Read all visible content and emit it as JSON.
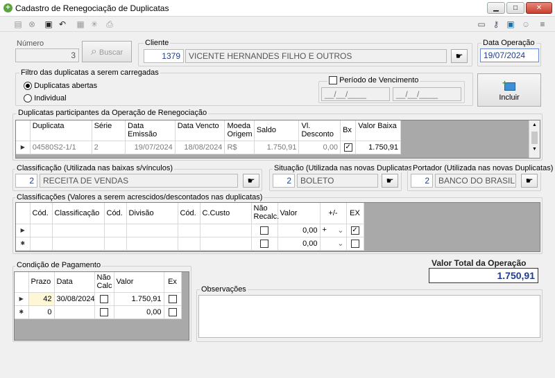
{
  "window": {
    "title": "Cadastro de Renegociação de Duplicatas",
    "minimize": "▁",
    "maximize": "□",
    "close": "✕"
  },
  "numero": {
    "label": "Número",
    "value": "3"
  },
  "buscar_label": "Buscar",
  "cliente": {
    "label": "Cliente",
    "code": "1379",
    "name": "VICENTE HERNANDES FILHO E OUTROS"
  },
  "data_operacao": {
    "label": "Data Operação",
    "value": "19/07/2024"
  },
  "filtro": {
    "label": "Filtro das duplicatas a serem carregadas",
    "opt1": "Duplicatas abertas",
    "opt2": "Individual",
    "periodo_label": "Período de Vencimento",
    "periodo_ini": "__/__/____",
    "periodo_fim": "__/__/____"
  },
  "incluir_label": "Incluir",
  "duplicatas": {
    "label": "Duplicatas participantes da Operação de Renegociação",
    "headers": [
      "Duplicata",
      "Série",
      "Data Emissão",
      "Data Vencto",
      "Moeda Origem",
      "Saldo",
      "Vl. Desconto",
      "Bx",
      "Valor Baixa"
    ],
    "row": {
      "duplicata": "04580S2-1/1",
      "serie": "2",
      "emissao": "19/07/2024",
      "vencto": "18/08/2024",
      "moeda": "R$",
      "saldo": "1.750,91",
      "desconto": "0,00",
      "valor_baixa": "1.750,91"
    }
  },
  "classificacao": {
    "label": "Classificação (Utilizada nas baixas s/vínculos)",
    "code": "2",
    "name": "RECEITA DE VENDAS"
  },
  "situacao": {
    "label": "Situação (Utilizada nas novas Duplicatas)",
    "code": "2",
    "name": "BOLETO"
  },
  "portador": {
    "label": "Portador (Utilizada nas novas Duplicatas)",
    "code": "2",
    "name": "BANCO DO BRASIL"
  },
  "classificacoes": {
    "label": "Classificações (Valores a serem acrescidos/descontados nas duplicatas)",
    "headers": [
      "Cód.",
      "Classificação",
      "Cód.",
      "Divisão",
      "Cód.",
      "C.Custo",
      "Não Recalc.",
      "Valor",
      "+/-",
      "EX"
    ],
    "rows": [
      {
        "valor": "0,00",
        "sinal": "+"
      },
      {
        "valor": "0,00",
        "sinal": ""
      }
    ]
  },
  "condicao": {
    "label": "Condição de Pagamento",
    "headers": [
      "Prazo",
      "Data",
      "Não Calc",
      "Valor",
      "Ex"
    ],
    "rows": [
      {
        "prazo": "42",
        "data": "30/08/2024",
        "valor": "1.750,91"
      },
      {
        "prazo": "0",
        "data": "",
        "valor": "0,00"
      }
    ]
  },
  "valor_total": {
    "label": "Valor Total da Operação",
    "value": "1.750,91"
  },
  "observacoes_label": "Observações",
  "glyphs": {
    "row_current": "▶",
    "row_new": "✱",
    "checkmark": "✓",
    "chevron": "⌄",
    "scroll_up": "▲",
    "scroll_down": "▼",
    "search": "⌕",
    "lookup": "☛",
    "plus": "+"
  },
  "icons": [
    "new-icon",
    "cancel-icon",
    "save-icon",
    "undo-icon",
    "grid-icon",
    "refresh-icon",
    "print-icon",
    "report-icon",
    "key-icon",
    "help-icon",
    "user-icon",
    "menu-icon"
  ]
}
